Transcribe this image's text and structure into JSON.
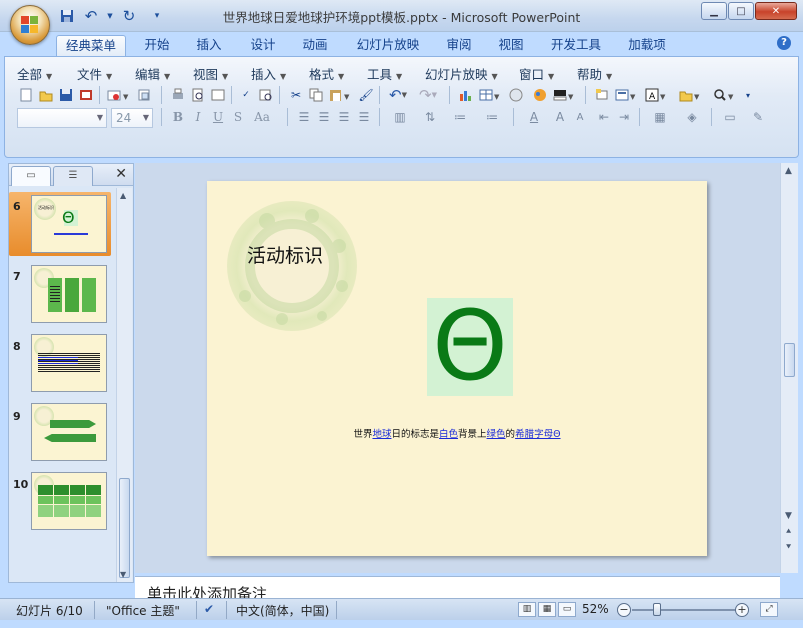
{
  "window": {
    "title": "世界地球日爱地球护环境ppt模板.pptx - Microsoft PowerPoint",
    "quick_access": [
      "save-icon",
      "undo-icon",
      "redo-icon",
      "customize-icon"
    ]
  },
  "ribbon": {
    "tabs": [
      "经典菜单",
      "开始",
      "插入",
      "设计",
      "动画",
      "幻灯片放映",
      "审阅",
      "视图",
      "开发工具",
      "加载项"
    ],
    "active_tab": "经典菜单",
    "menus": [
      "全部",
      "文件",
      "编辑",
      "视图",
      "插入",
      "格式",
      "工具",
      "幻灯片放映",
      "窗口",
      "帮助"
    ],
    "font_name_value": "",
    "font_size_value": "24",
    "format_buttons": [
      "B",
      "I",
      "U",
      "S",
      "Aa"
    ]
  },
  "slides_panel": {
    "thumbnails": [
      {
        "number": "6",
        "selected": true
      },
      {
        "number": "7",
        "selected": false
      },
      {
        "number": "8",
        "selected": false
      },
      {
        "number": "9",
        "selected": false
      },
      {
        "number": "10",
        "selected": false
      }
    ]
  },
  "slide": {
    "title": "活动标识",
    "symbol": "Θ",
    "caption_parts": [
      {
        "text": "世界",
        "link": false
      },
      {
        "text": "地球",
        "link": true
      },
      {
        "text": "日的标志是",
        "link": false
      },
      {
        "text": "白色",
        "link": true
      },
      {
        "text": "背景上",
        "link": false
      },
      {
        "text": "绿色",
        "link": true
      },
      {
        "text": "的",
        "link": false
      },
      {
        "text": "希腊字母Θ",
        "link": true
      }
    ]
  },
  "notes": {
    "placeholder": "单击此处添加备注"
  },
  "status_bar": {
    "slide_info": "幻灯片 6/10",
    "theme": "\"Office 主题\"",
    "language": "中文(简体，中国)",
    "zoom": "52%"
  },
  "colors": {
    "slide_background": "#fbf3d2",
    "symbol_green": "#0a7a16",
    "link_blue": "#1a2bd8",
    "selected_thumb": "#e88c2c"
  }
}
